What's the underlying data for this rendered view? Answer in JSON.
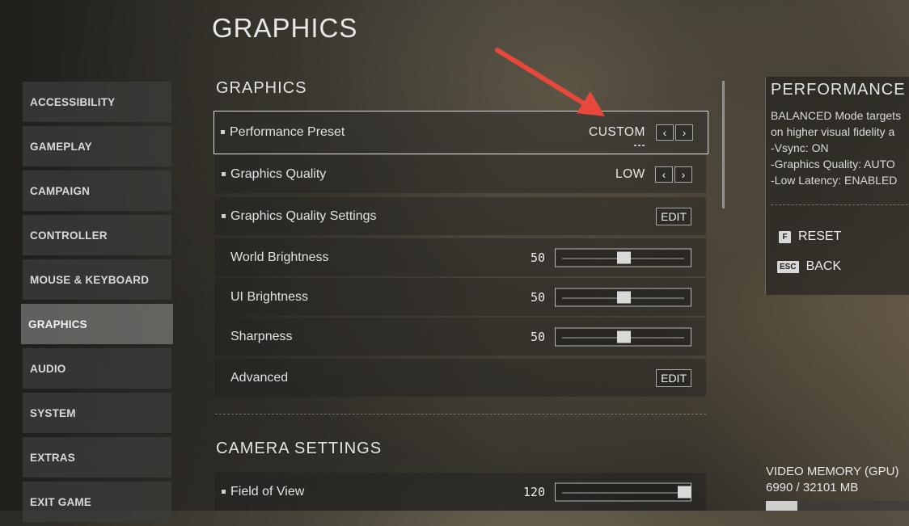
{
  "page_title": "GRAPHICS",
  "nav": {
    "items": [
      {
        "label": "ACCESSIBILITY"
      },
      {
        "label": "GAMEPLAY"
      },
      {
        "label": "CAMPAIGN"
      },
      {
        "label": "CONTROLLER"
      },
      {
        "label": "MOUSE & KEYBOARD"
      },
      {
        "label": "GRAPHICS",
        "active": true
      },
      {
        "label": "AUDIO"
      },
      {
        "label": "SYSTEM"
      },
      {
        "label": "EXTRAS"
      },
      {
        "label": "EXIT GAME"
      }
    ]
  },
  "graphics": {
    "section_title": "GRAPHICS",
    "performance_preset": {
      "label": "Performance Preset",
      "value": "CUSTOM",
      "prev_icon": "chevron-left-icon",
      "next_icon": "chevron-right-icon"
    },
    "graphics_quality": {
      "label": "Graphics Quality",
      "value": "LOW",
      "prev_icon": "chevron-left-icon",
      "next_icon": "chevron-right-icon"
    },
    "graphics_quality_settings": {
      "label": "Graphics Quality Settings",
      "button": "EDIT"
    },
    "world_brightness": {
      "label": "World Brightness",
      "value": "50",
      "level": 0.5
    },
    "ui_brightness": {
      "label": "UI Brightness",
      "value": "50",
      "level": 0.5
    },
    "sharpness": {
      "label": "Sharpness",
      "value": "50",
      "level": 0.5
    },
    "advanced": {
      "label": "Advanced",
      "button": "EDIT"
    }
  },
  "camera": {
    "section_title": "CAMERA SETTINGS",
    "field_of_view": {
      "label": "Field of View",
      "value": "120",
      "level": 1.0
    }
  },
  "info_panel": {
    "title": "PERFORMANCE P",
    "lines": [
      "BALANCED Mode targets",
      "on higher visual fidelity a",
      "-Vsync: ON",
      "-Graphics Quality: AUTO",
      "-Low Latency: ENABLED"
    ]
  },
  "actions": {
    "reset": {
      "key": "F",
      "label": "RESET"
    },
    "back": {
      "key": "ESC",
      "label": "BACK"
    }
  },
  "video_memory": {
    "label": "VIDEO MEMORY (GPU)",
    "value": "6990 / 32101 MB",
    "fraction": 0.218
  },
  "colors": {
    "annotation_arrow": "#e8473b",
    "accent_light": "#d9d9d9"
  }
}
